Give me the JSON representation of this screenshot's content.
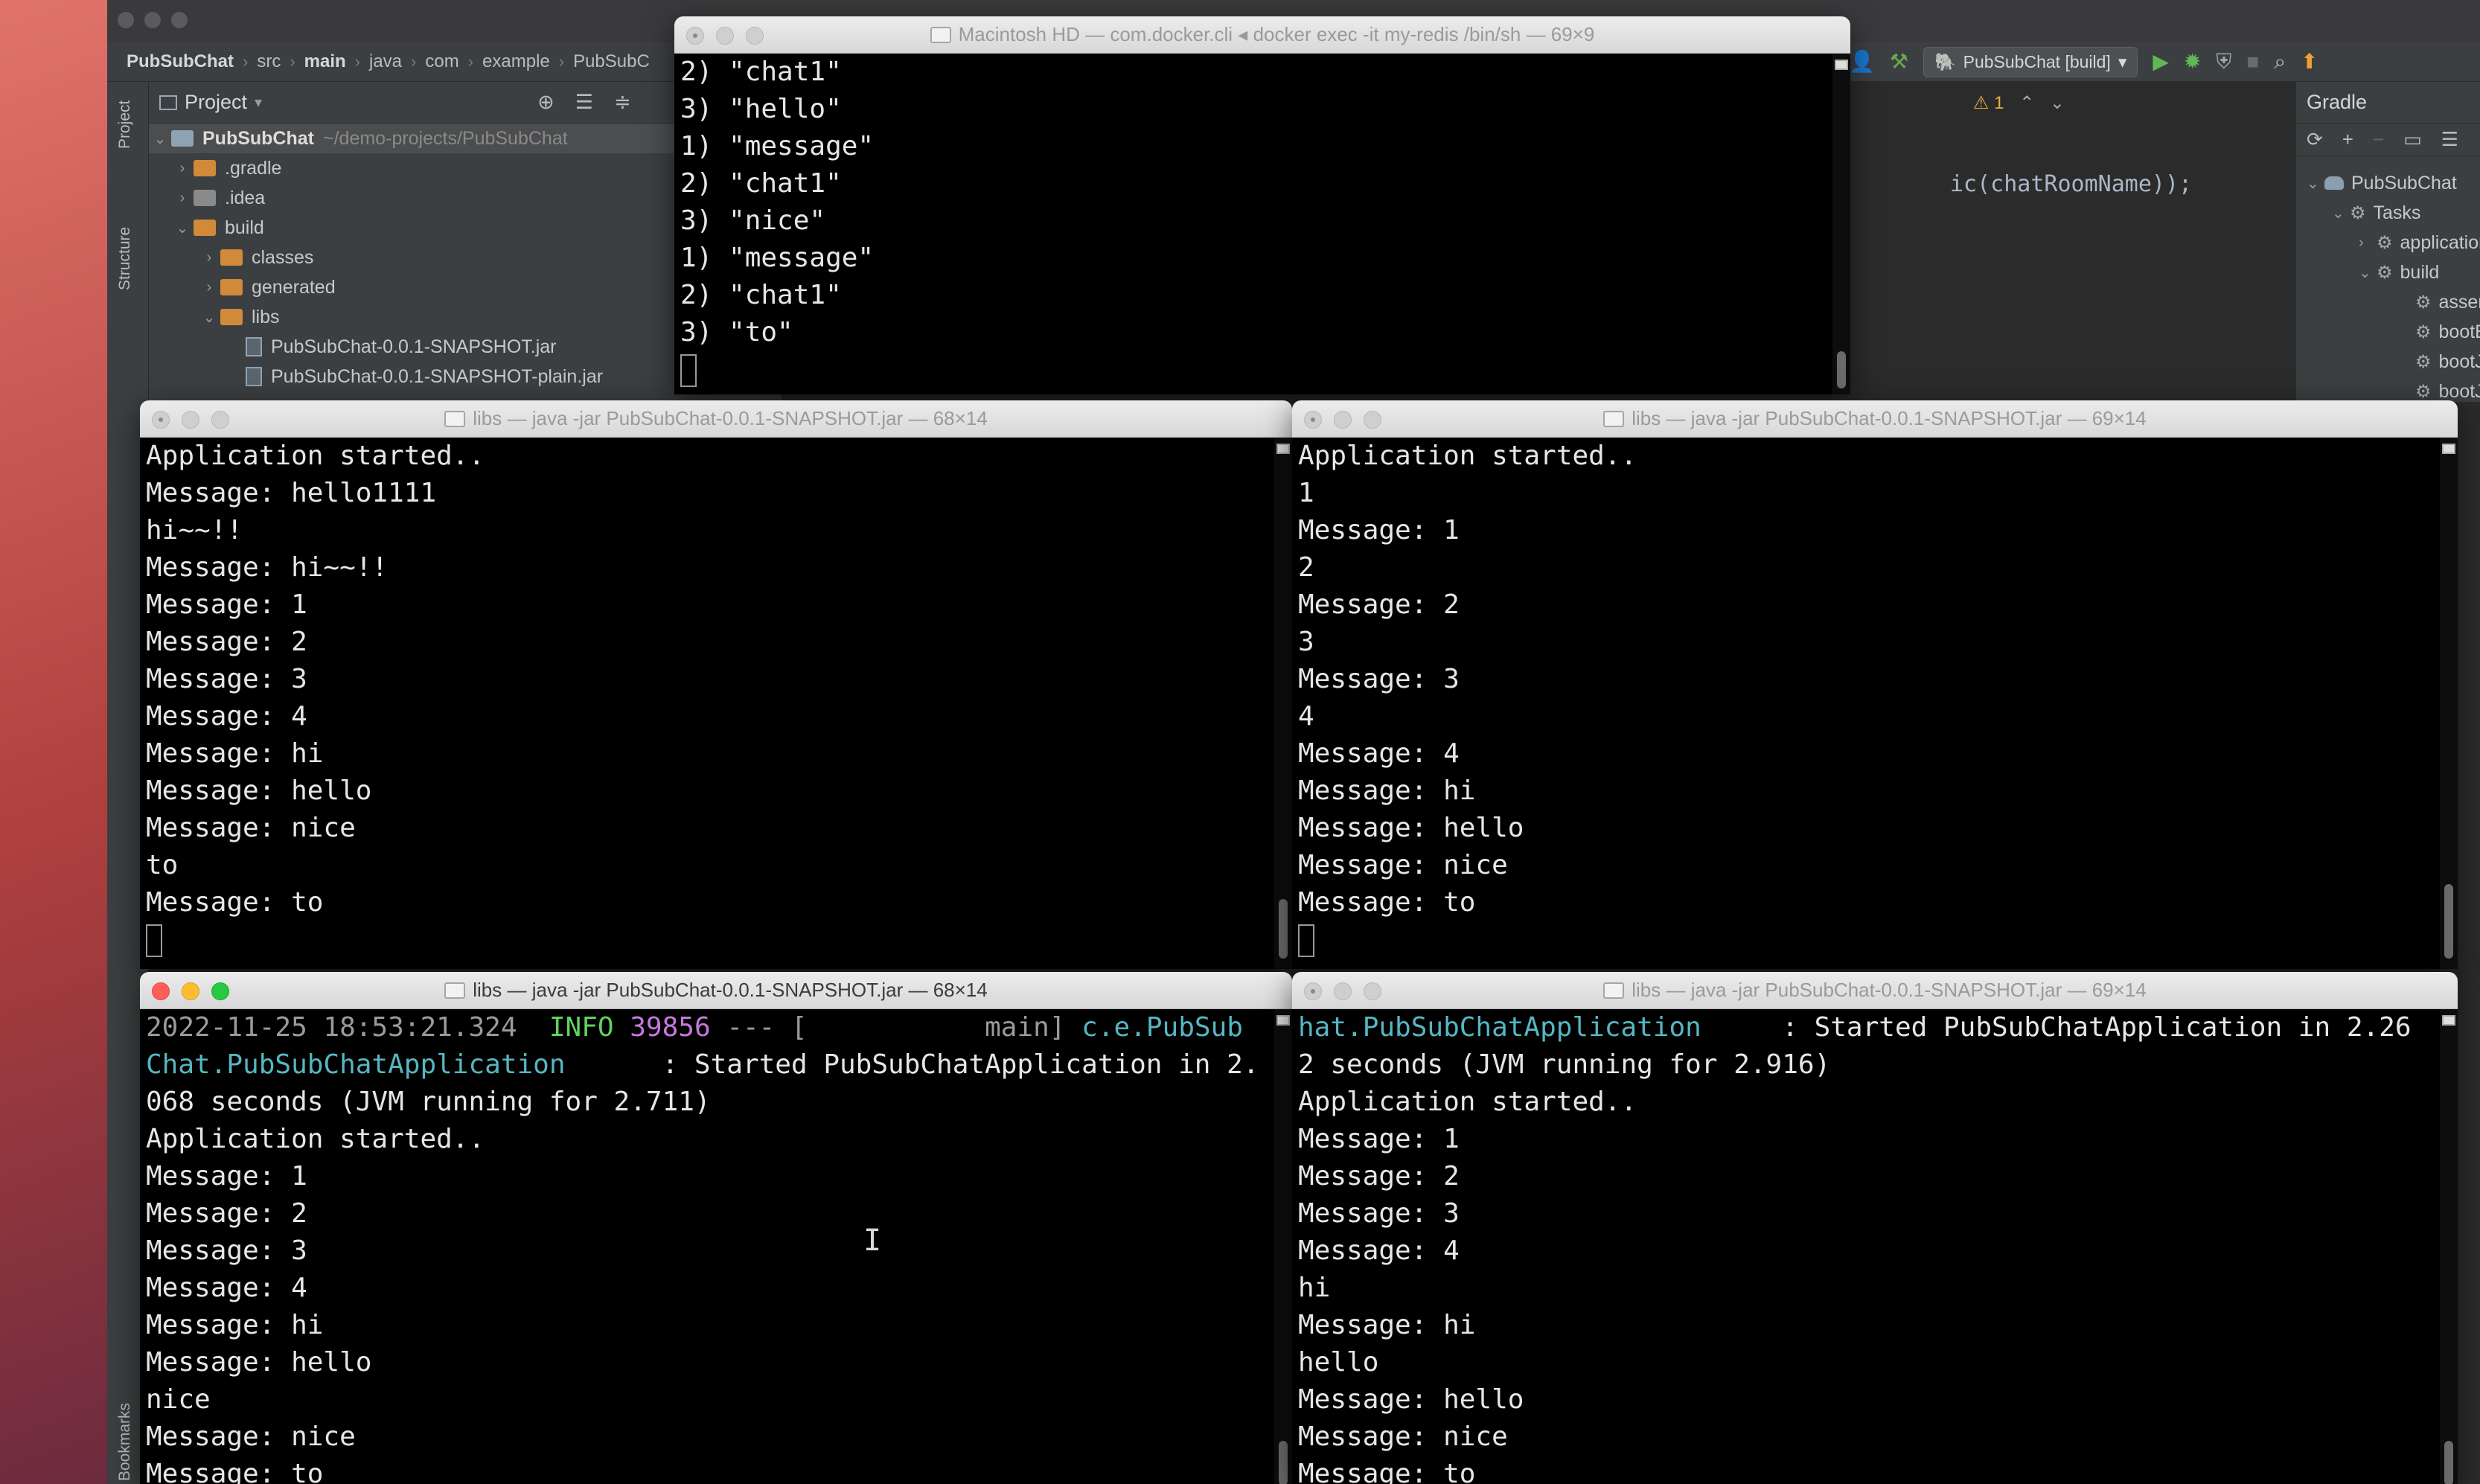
{
  "ide": {
    "breadcrumbs": [
      "PubSubChat",
      "src",
      "main",
      "java",
      "com",
      "example",
      "PubSubC"
    ],
    "run_config": "PubSubChat [build]",
    "warning_count": "1",
    "editor_snippet": "ic(chatRoomName));",
    "side_tabs": {
      "project": "Project",
      "structure": "Structure",
      "bookmarks": "Bookmarks"
    },
    "project_panel": {
      "title": "Project",
      "root_name": "PubSubChat",
      "root_path": "~/demo-projects/PubSubChat",
      "items": [
        ".gradle",
        ".idea",
        "build",
        "classes",
        "generated",
        "libs",
        "PubSubChat-0.0.1-SNAPSHOT.jar",
        "PubSubChat-0.0.1-SNAPSHOT-plain.jar"
      ]
    },
    "gradle_panel": {
      "title": "Gradle",
      "items": [
        "PubSubChat",
        "Tasks",
        "application",
        "build",
        "assemble",
        "bootBuildImag",
        "bootJar",
        "bootJarMainCl"
      ]
    }
  },
  "terminals": {
    "redis": {
      "title": "Macintosh HD — com.docker.cli ◂ docker exec -it my-redis /bin/sh — 69×9",
      "lines": [
        "2) \"chat1\"",
        "3) \"hello\"",
        "1) \"message\"",
        "2) \"chat1\"",
        "3) \"nice\"",
        "1) \"message\"",
        "2) \"chat1\"",
        "3) \"to\""
      ]
    },
    "top_left": {
      "title": "libs — java -jar PubSubChat-0.0.1-SNAPSHOT.jar — 68×14",
      "lines": [
        "Application started..",
        "Message: hello1111",
        "hi~~!!",
        "Message: hi~~!!",
        "Message: 1",
        "Message: 2",
        "Message: 3",
        "Message: 4",
        "Message: hi",
        "Message: hello",
        "Message: nice",
        "to",
        "Message: to"
      ]
    },
    "top_right": {
      "title": "libs — java -jar PubSubChat-0.0.1-SNAPSHOT.jar — 69×14",
      "lines": [
        "Application started..",
        "1",
        "Message: 1",
        "2",
        "Message: 2",
        "3",
        "Message: 3",
        "4",
        "Message: 4",
        "Message: hi",
        "Message: hello",
        "Message: nice",
        "Message: to"
      ]
    },
    "bottom_left": {
      "title": "libs — java -jar PubSubChat-0.0.1-SNAPSHOT.jar — 68×14",
      "log_timestamp": "2022-11-25 18:53:21.324",
      "log_level": "INFO",
      "log_pid": "39856",
      "log_sep": "--- [",
      "log_thread": "main]",
      "log_class": "c.e.PubSub",
      "lines": [
        "Chat.PubSubChatApplication      : Started PubSubChatApplication in 2.",
        "068 seconds (JVM running for 2.711)",
        "Application started..",
        "Message: 1",
        "Message: 2",
        "Message: 3",
        "Message: 4",
        "Message: hi",
        "Message: hello",
        "nice",
        "Message: nice",
        "Message: to"
      ]
    },
    "bottom_right": {
      "title": "libs — java -jar PubSubChat-0.0.1-SNAPSHOT.jar — 69×14",
      "log_class": "hat.PubSubChatApplication",
      "log_rest": "     : Started PubSubChatApplication in 2.26",
      "lines": [
        "2 seconds (JVM running for 2.916)",
        "Application started..",
        "Message: 1",
        "Message: 2",
        "Message: 3",
        "Message: 4",
        "hi",
        "Message: hi",
        "hello",
        "Message: hello",
        "Message: nice",
        "Message: to"
      ]
    }
  },
  "colors": {
    "info": "#5fd35f",
    "pid": "#c678dd",
    "class": "#56b6c2",
    "close": "#ff5f57",
    "minimize": "#febc2e",
    "zoom": "#28c840"
  }
}
